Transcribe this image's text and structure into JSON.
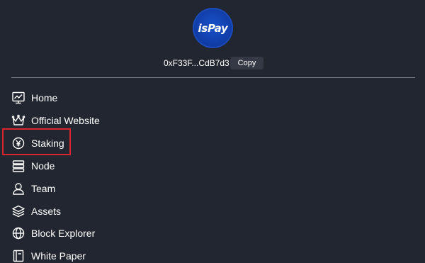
{
  "header": {
    "logo_text": "isPay",
    "wallet_address": "0xF33F...CdB7d3",
    "copy_label": "Copy"
  },
  "menu": {
    "items": [
      {
        "label": "Home",
        "icon": "chart-icon"
      },
      {
        "label": "Official Website",
        "icon": "crown-icon"
      },
      {
        "label": "Staking",
        "icon": "yen-coin-icon"
      },
      {
        "label": "Node",
        "icon": "server-icon"
      },
      {
        "label": "Team",
        "icon": "user-icon"
      },
      {
        "label": "Assets",
        "icon": "layers-icon"
      },
      {
        "label": "Block Explorer",
        "icon": "globe-icon"
      },
      {
        "label": "White Paper",
        "icon": "document-icon"
      }
    ]
  },
  "colors": {
    "background": "#222630",
    "logo_blue": "#0e3aa3",
    "highlight_red": "#d8262e",
    "copy_button": "#343945"
  }
}
